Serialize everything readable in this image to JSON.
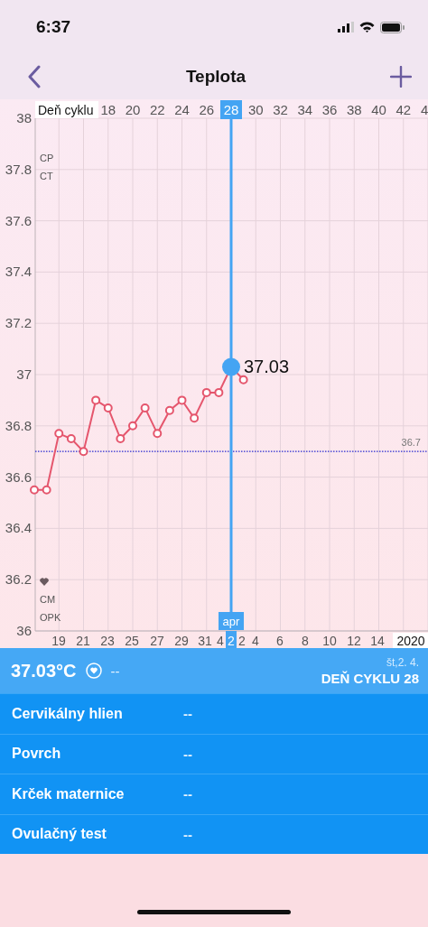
{
  "status_bar": {
    "time": "6:37"
  },
  "nav": {
    "title": "Teplota"
  },
  "chart": {
    "axis_title": "Deň cyklu",
    "top_markers": [
      "CP",
      "CT"
    ],
    "bottom_markers": [
      "CM",
      "OPK"
    ],
    "edge_tick": "4",
    "month_label": "apr",
    "date_labels": [
      {
        "label": "19",
        "selected": false
      },
      {
        "label": "21",
        "selected": false
      },
      {
        "label": "23",
        "selected": false
      },
      {
        "label": "25",
        "selected": false
      },
      {
        "label": "27",
        "selected": false
      },
      {
        "label": "29",
        "selected": false
      },
      {
        "label": "31",
        "selected": false
      },
      {
        "label": "4",
        "selected": false
      },
      {
        "label": "2",
        "selected": true
      },
      {
        "label": "2",
        "selected": false
      },
      {
        "label": "4",
        "selected": false
      },
      {
        "label": "6",
        "selected": false
      },
      {
        "label": "8",
        "selected": false
      },
      {
        "label": "10",
        "selected": false
      },
      {
        "label": "12",
        "selected": false
      },
      {
        "label": "14",
        "selected": false
      },
      {
        "label": "2020",
        "selected": false
      }
    ],
    "chart_data": {
      "type": "line",
      "xlim": [
        12,
        44
      ],
      "ylim": [
        36,
        38
      ],
      "x": [
        12,
        13,
        14,
        15,
        16,
        17,
        18,
        19,
        20,
        21,
        22,
        23,
        24,
        25,
        26,
        27,
        28,
        29
      ],
      "grid": true,
      "series": [
        {
          "color": "#e5566d",
          "marker": "o",
          "values": [
            36.55,
            36.55,
            36.77,
            36.75,
            36.7,
            36.9,
            36.87,
            36.75,
            36.8,
            36.87,
            36.77,
            36.86,
            36.9,
            36.83,
            36.93,
            36.93,
            37.03,
            36.98
          ]
        }
      ],
      "yticks": [
        {
          "value": 36,
          "label": "36"
        },
        {
          "value": 36.2,
          "label": "36.2"
        },
        {
          "value": 36.4,
          "label": "36.4"
        },
        {
          "value": 36.6,
          "label": "36.6"
        },
        {
          "value": 36.8,
          "label": "36.8"
        },
        {
          "value": 37,
          "label": "37"
        },
        {
          "value": 37.2,
          "label": "37.2"
        },
        {
          "value": 37.4,
          "label": "37.4"
        },
        {
          "value": 37.6,
          "label": "37.6"
        },
        {
          "value": 37.8,
          "label": "37.8"
        },
        {
          "value": 38,
          "label": "38"
        }
      ],
      "xticks": [
        18,
        20,
        22,
        24,
        26,
        28,
        30,
        32,
        34,
        36,
        38,
        40,
        42
      ],
      "annotations": [
        {
          "x": 28,
          "y": 37.03,
          "text": "37.03"
        }
      ],
      "ref_lines": [
        {
          "axis": "y",
          "value": 36.7,
          "label": "36.7"
        },
        {
          "axis": "x",
          "value": 28
        }
      ]
    }
  },
  "summary": {
    "temperature": "37.03°C",
    "sex": "--",
    "date": "št,2. 4.",
    "cycle_day": "DEŇ CYKLU 28"
  },
  "rows": [
    {
      "label": "Cervikálny hlien",
      "value": "--"
    },
    {
      "label": "Povrch",
      "value": "--"
    },
    {
      "label": "Krček maternice",
      "value": "--"
    },
    {
      "label": "Ovulačný test",
      "value": "--"
    }
  ]
}
